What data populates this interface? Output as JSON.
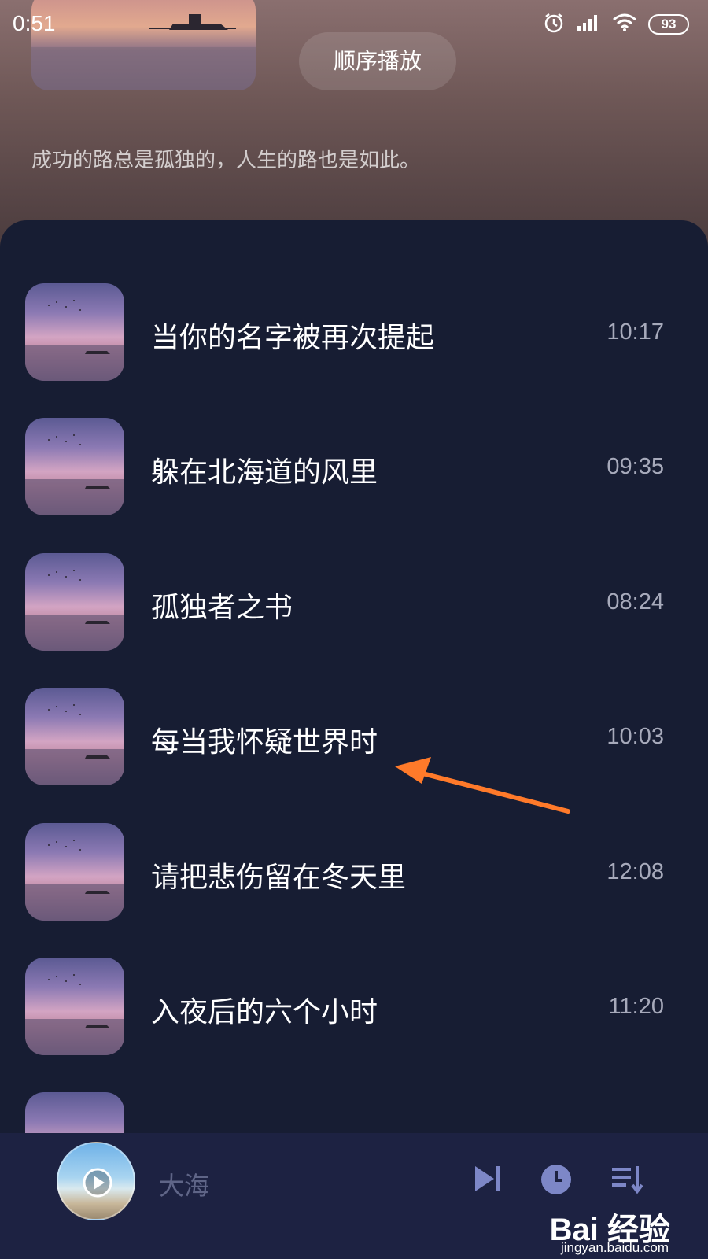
{
  "status_bar": {
    "time": "0:51",
    "battery": "93"
  },
  "header": {
    "play_order_label": "顺序播放",
    "description": "成功的路总是孤独的，人生的路也是如此。"
  },
  "songs": [
    {
      "title": "当你的名字被再次提起",
      "duration": "10:17"
    },
    {
      "title": "躲在北海道的风里",
      "duration": "09:35"
    },
    {
      "title": "孤独者之书",
      "duration": "08:24"
    },
    {
      "title": "每当我怀疑世界时",
      "duration": "10:03"
    },
    {
      "title": "请把悲伤留在冬天里",
      "duration": "12:08"
    },
    {
      "title": "入夜后的六个小时",
      "duration": "11:20"
    }
  ],
  "player": {
    "now_playing": "大海"
  },
  "watermark": {
    "brand": "Bai 经验",
    "url": "jingyan.baidu.com"
  },
  "colors": {
    "panel_bg": "#171d33",
    "player_bg": "#1d2242",
    "accent_icons": "#7d87c7",
    "annotation_arrow": "#ff7a2a"
  },
  "icons": [
    "alarm-icon",
    "signal-icon",
    "wifi-icon",
    "battery-icon",
    "play-icon",
    "skip-next-icon",
    "timer-icon",
    "playlist-icon"
  ]
}
